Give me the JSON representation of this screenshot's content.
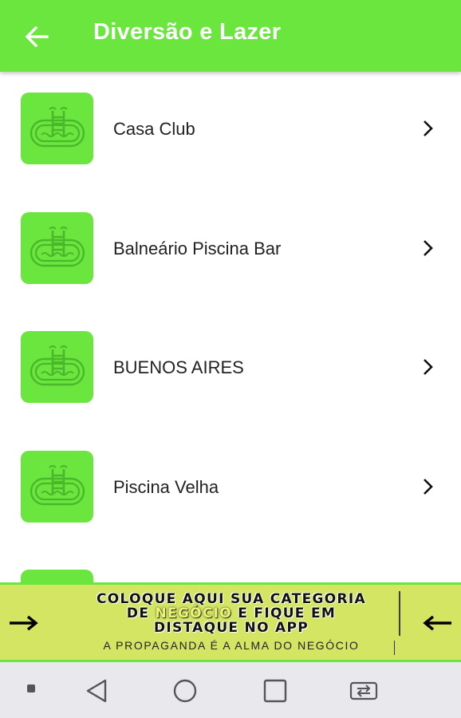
{
  "header": {
    "title": "Diversão e Lazer",
    "back_icon": "arrow-left-icon",
    "background": "#6ae63e"
  },
  "list": {
    "items": [
      {
        "label": "Casa Club",
        "icon": "pool-ladder-icon"
      },
      {
        "label": "Balneário Piscina Bar",
        "icon": "pool-ladder-icon"
      },
      {
        "label": "BUENOS AIRES",
        "icon": "pool-ladder-icon"
      },
      {
        "label": "Piscina Velha",
        "icon": "pool-ladder-icon"
      }
    ]
  },
  "banner": {
    "line1": "COLOQUE AQUI SUA CATEGORIA",
    "line2_prefix": "DE",
    "line2_highlight": "NEGÓCIO",
    "line2_suffix": "E FIQUE EM",
    "line3": "DISTAQUE NO APP",
    "subtitle": "A PROPAGANDA É A ALMA DO NEGÓCIO",
    "background": "#d4e563"
  },
  "navbar": {
    "buttons": [
      "dot-icon",
      "back-triangle-icon",
      "home-circle-icon",
      "recents-square-icon",
      "rotate-icon"
    ]
  }
}
